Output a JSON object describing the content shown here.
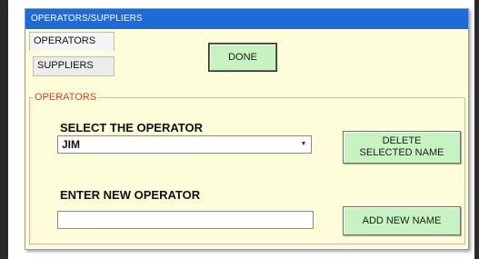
{
  "window": {
    "title": "OPERATORS/SUPPLIERS"
  },
  "tabs": {
    "operators": "OPERATORS",
    "suppliers": "SUPPLIERS"
  },
  "toolbar": {
    "done_label": "DONE"
  },
  "panel": {
    "legend": "OPERATORS",
    "select_label": "SELECT THE OPERATOR",
    "selected_operator": "JIM",
    "delete_label_line1": "DELETE",
    "delete_label_line2": "SELECTED NAME",
    "enter_label": "ENTER NEW OPERATOR",
    "new_operator_value": "",
    "add_label": "ADD NEW NAME"
  },
  "colors": {
    "titlebar": "#1e6ad6",
    "panel_bg": "#fdfdd9",
    "button_bg": "#c7f3c2",
    "legend": "#e13a1a"
  },
  "icons": {
    "combo_arrow": "dropdown-arrow-icon"
  }
}
